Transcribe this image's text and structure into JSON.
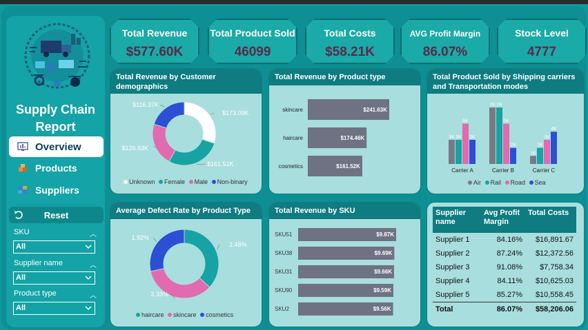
{
  "app": {
    "title": "Supply Chain Report"
  },
  "nav": {
    "items": [
      {
        "label": "Overview",
        "icon": "dashboard-icon",
        "active": true
      },
      {
        "label": "Products",
        "icon": "boxes-icon",
        "active": false
      },
      {
        "label": "Suppliers",
        "icon": "supplier-icon",
        "active": false
      }
    ],
    "reset_label": "Reset"
  },
  "filters": [
    {
      "label": "SKU",
      "value": "All"
    },
    {
      "label": "Supplier name",
      "value": "All"
    },
    {
      "label": "Product type",
      "value": "All"
    }
  ],
  "kpis": [
    {
      "label": "Total Revenue",
      "value": "$577.60K"
    },
    {
      "label": "Total Product Sold",
      "value": "46099"
    },
    {
      "label": "Total Costs",
      "value": "$58.21K"
    },
    {
      "label": "AVG Profit Margin",
      "value": "86.07%"
    },
    {
      "label": "Stock Level",
      "value": "4777"
    }
  ],
  "colors": {
    "teal": "#17a2a3",
    "pink": "#e26aae",
    "blue": "#2d4fd4",
    "white": "#ffffff",
    "grey": "#777a86",
    "bar": "#6e7282",
    "header": "#0e7c80"
  },
  "chart_data": [
    {
      "type": "pie",
      "title": "Total Revenue by Customer demographics",
      "categories": [
        "Unknown",
        "Female",
        "Male",
        "Non-binary"
      ],
      "values": [
        173.09,
        161.51,
        126.63,
        116.37
      ],
      "labels": [
        "$173.09K",
        "$161.51K",
        "$126.63K",
        "$116.37K"
      ]
    },
    {
      "type": "bar",
      "title": "Total Revenue by Product type",
      "categories": [
        "skincare",
        "haircare",
        "cosmetics"
      ],
      "values": [
        241.63,
        174.46,
        161.52
      ],
      "labels": [
        "$241.63K",
        "$174.46K",
        "$161.52K"
      ]
    },
    {
      "type": "bar",
      "title": "Total Product Sold by Shipping carriers and Transportation modes",
      "categories": [
        "Carrier A",
        "Carrier B",
        "Carrier C"
      ],
      "series": [
        {
          "name": "Air",
          "values": [
            3,
            7,
            1
          ],
          "labels": [
            "3K",
            "7K",
            "1K"
          ]
        },
        {
          "name": "Rail",
          "values": [
            3,
            7,
            2
          ],
          "labels": [
            "3K",
            "7K",
            "2K"
          ]
        },
        {
          "name": "Road",
          "values": [
            5,
            5,
            3
          ],
          "labels": [
            "5K",
            "5K",
            "3K"
          ]
        },
        {
          "name": "Sea",
          "values": [
            3,
            2,
            4
          ],
          "labels": [
            "3K",
            "2K",
            "4K"
          ]
        }
      ]
    },
    {
      "type": "pie",
      "title": "Average Defect Rate by Product Type",
      "categories": [
        "haircare",
        "skincare",
        "cosmetics"
      ],
      "values": [
        2.48,
        2.33,
        1.92
      ],
      "labels": [
        "2.48%",
        "2.33%",
        "1.92%"
      ]
    },
    {
      "type": "bar",
      "title": "Total Revenue by SKU",
      "categories": [
        "SKU51",
        "SKU38",
        "SKU31",
        "SKU90",
        "SKU2"
      ],
      "values": [
        9.87,
        9.69,
        9.66,
        9.59,
        9.56
      ],
      "labels": [
        "$9.87K",
        "$9.69K",
        "$9.66K",
        "$9.59K",
        "$9.56K"
      ]
    }
  ],
  "supplier_table": {
    "headers": [
      "Supplier name",
      "Avg Profit Margin",
      "Total Costs"
    ],
    "rows": [
      [
        "Supplier 1",
        "84.16%",
        "$16,891.67"
      ],
      [
        "Supplier 2",
        "87.24%",
        "$12,372.56"
      ],
      [
        "Supplier 3",
        "91.08%",
        "$7,758.34"
      ],
      [
        "Supplier 4",
        "84.11%",
        "$10,625.03"
      ],
      [
        "Supplier 5",
        "85.27%",
        "$10,558.45"
      ]
    ],
    "total": [
      "Total",
      "86.07%",
      "$58,206.06"
    ]
  }
}
